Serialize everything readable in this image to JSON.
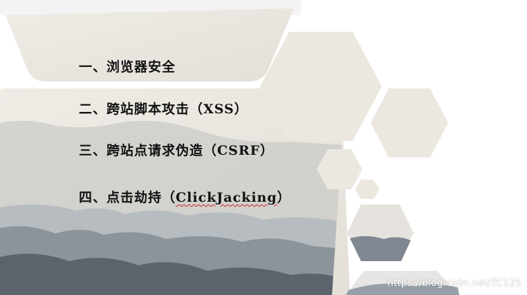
{
  "slide": {
    "items": [
      {
        "label": "一、浏览器安全"
      },
      {
        "label": "二、跨站脚本攻击（XSS）"
      },
      {
        "label": "三、跨站点请求伪造（CSRF）"
      },
      {
        "label_prefix": "四、点击劫持（",
        "label_term": "ClickJacking",
        "label_suffix": "）"
      }
    ],
    "watermark": "https://blog.csdn.net/TC125"
  },
  "colors": {
    "paper": "#ece8e0",
    "paper_light": "#f2f0eb",
    "mountain_light": "#b7bcc0",
    "mountain_mid": "#8c949b",
    "mountain_dark": "#5b636b",
    "text": "#111111",
    "spell_underline": "#d21f1f"
  }
}
